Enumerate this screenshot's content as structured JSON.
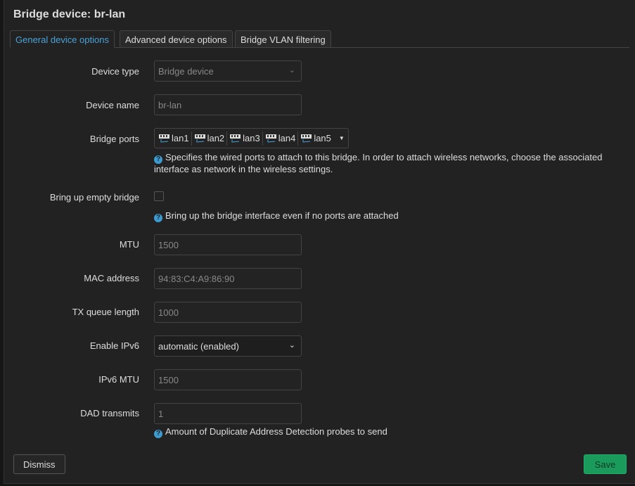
{
  "title": "Bridge device: br-lan",
  "tabs": [
    {
      "label": "General device options",
      "active": true
    },
    {
      "label": "Advanced device options"
    },
    {
      "label": "Bridge VLAN filtering"
    }
  ],
  "fields": {
    "device_type": {
      "label": "Device type",
      "value": "Bridge device"
    },
    "device_name": {
      "label": "Device name",
      "value": "br-lan"
    },
    "bridge_ports": {
      "label": "Bridge ports",
      "ports": [
        "lan1",
        "lan2",
        "lan3",
        "lan4",
        "lan5"
      ],
      "description": "Specifies the wired ports to attach to this bridge. In order to attach wireless networks, choose the associated interface as network in the wireless settings."
    },
    "empty_bridge": {
      "label": "Bring up empty bridge",
      "checked": false,
      "description": "Bring up the bridge interface even if no ports are attached"
    },
    "mtu": {
      "label": "MTU",
      "placeholder": "1500"
    },
    "mac": {
      "label": "MAC address",
      "placeholder": "94:83:C4:A9:86:90"
    },
    "txqueue": {
      "label": "TX queue length",
      "placeholder": "1000"
    },
    "ipv6": {
      "label": "Enable IPv6",
      "value": "automatic (enabled)"
    },
    "ipv6_mtu": {
      "label": "IPv6 MTU",
      "placeholder": "1500"
    },
    "dad": {
      "label": "DAD transmits",
      "placeholder": "1",
      "description": "Amount of Duplicate Address Detection probes to send"
    }
  },
  "buttons": {
    "dismiss": "Dismiss",
    "save": "Save"
  },
  "colors": {
    "accent": "#4aa3d8",
    "save": "#1a9b5c"
  }
}
